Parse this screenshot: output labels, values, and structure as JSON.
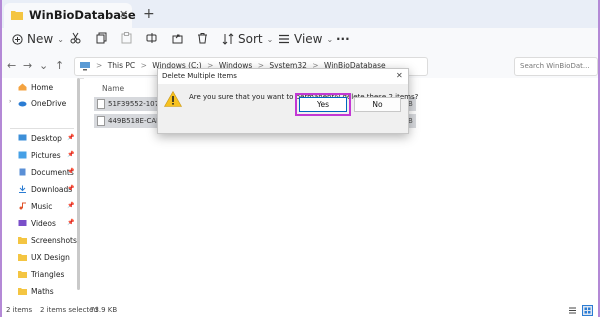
{
  "window": {
    "tab_title": "WinBioDatabase",
    "tab_close": "✕",
    "new_tab": "+"
  },
  "toolbar": {
    "new_label": "New",
    "sort_label": "Sort",
    "view_label": "View",
    "more_label": "···"
  },
  "address": {
    "crumbs": [
      "This PC",
      "Windows (C:)",
      "Windows",
      "System32",
      "WinBioDatabase"
    ],
    "separator": ">",
    "search_placeholder": "Search WinBioDat..."
  },
  "sidebar": {
    "items": [
      {
        "label": "Home"
      },
      {
        "label": "OneDrive"
      },
      {
        "label": "Desktop"
      },
      {
        "label": "Pictures"
      },
      {
        "label": "Documents"
      },
      {
        "label": "Downloads"
      },
      {
        "label": "Music"
      },
      {
        "label": "Videos"
      },
      {
        "label": "Screenshots"
      },
      {
        "label": "UX Design"
      },
      {
        "label": "Triangles"
      },
      {
        "label": "Maths"
      }
    ]
  },
  "content": {
    "column_name": "Name",
    "files": [
      {
        "name": "51F39552-1075-4"
      },
      {
        "name": "449B518E-CAE1-4"
      }
    ],
    "row_suffix": "B"
  },
  "status": {
    "items_count": "2 items",
    "selected": "2 items selected",
    "size": "73.9 KB"
  },
  "dialog": {
    "title": "Delete Multiple Items",
    "close": "✕",
    "message": "Are you sure that you want to permanently delete these 2 items?",
    "yes_label": "Yes",
    "no_label": "No"
  },
  "colors": {
    "accent_ring": "#c238d4",
    "folder_yellow": "#f4c542",
    "warning_yellow": "#f7c21f"
  }
}
